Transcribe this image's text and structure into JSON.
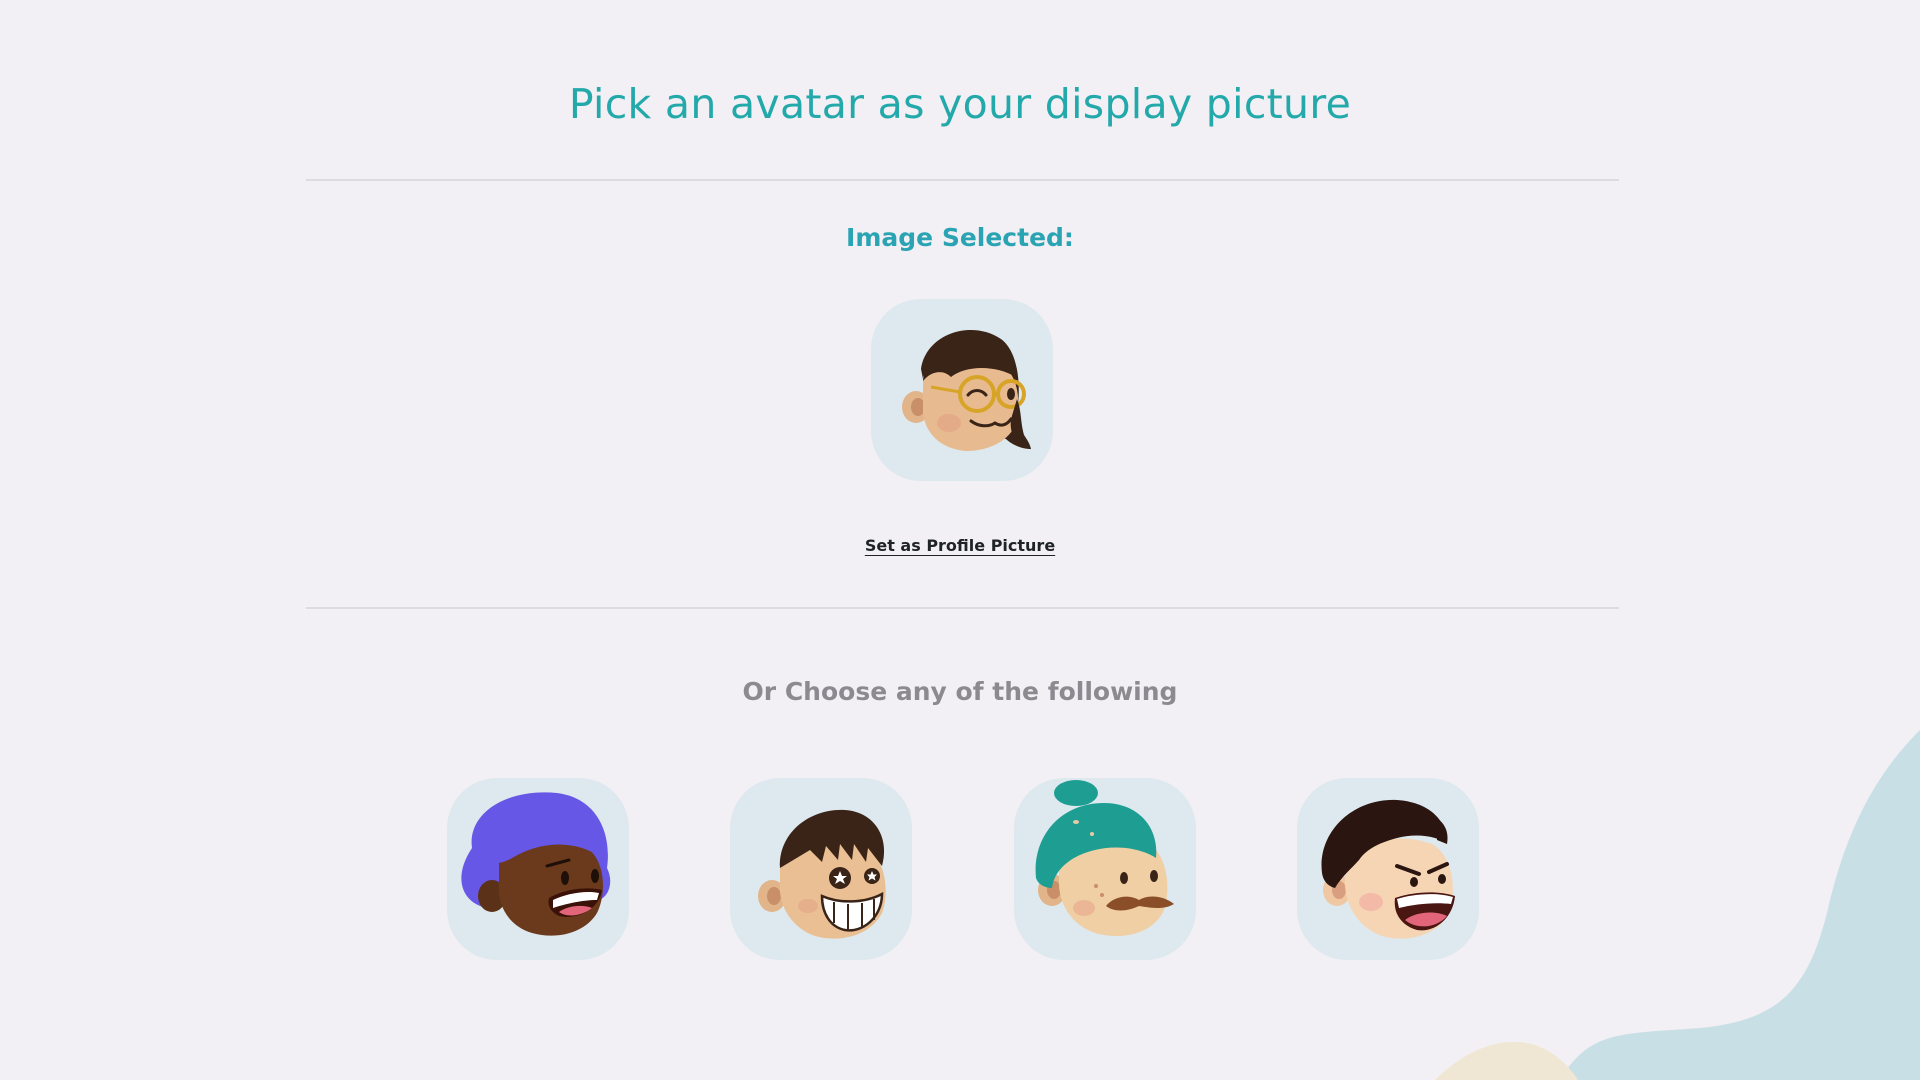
{
  "header": {
    "title": "Pick an avatar as your display picture"
  },
  "selection": {
    "label": "Image Selected:",
    "selected_avatar": "avatar-glasses-winking-icon",
    "set_button_label": "Set as Profile Picture"
  },
  "options": {
    "label": "Or Choose any of the following",
    "avatars": [
      "avatar-purple-hair-icon",
      "avatar-star-eyes-icon",
      "avatar-teal-bun-mustache-icon",
      "avatar-shouting-boy-icon"
    ]
  },
  "colors": {
    "background": "#f2f0f5",
    "accent": "#24a9ab",
    "tile": "#dde9ee",
    "muted_text": "#8c8a90",
    "blob": "#c9dfe6",
    "blob_secondary": "#efe7d4"
  }
}
